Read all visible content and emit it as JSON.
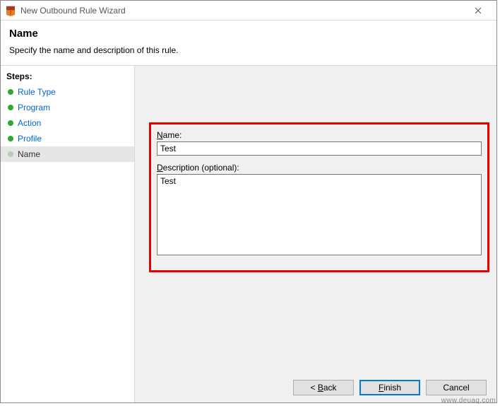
{
  "window": {
    "title": "New Outbound Rule Wizard"
  },
  "header": {
    "title": "Name",
    "subtitle": "Specify the name and description of this rule."
  },
  "sidebar": {
    "steps_header": "Steps:",
    "items": [
      {
        "label": "Rule Type"
      },
      {
        "label": "Program"
      },
      {
        "label": "Action"
      },
      {
        "label": "Profile"
      },
      {
        "label": "Name"
      }
    ]
  },
  "form": {
    "name_label": "ame:",
    "name_value": "Test",
    "description_label": "escription (optional):",
    "description_value": "Test"
  },
  "buttons": {
    "back": "ack",
    "finish": "inish",
    "cancel": "Cancel"
  },
  "watermark": "www.deuaq.com"
}
